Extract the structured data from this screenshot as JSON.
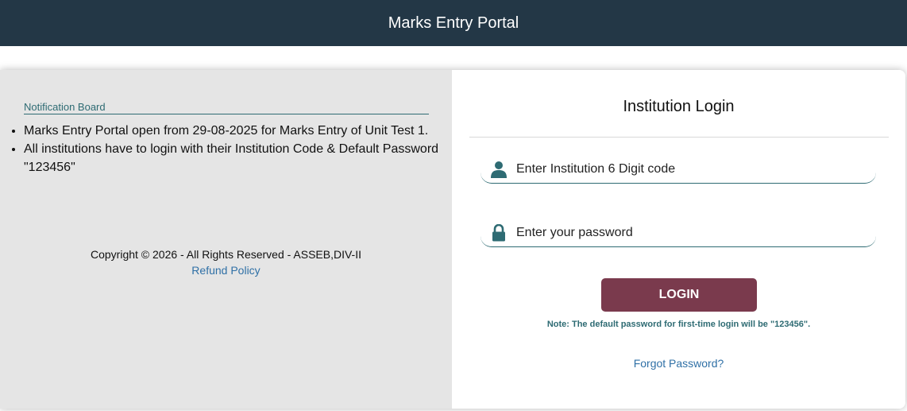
{
  "header": {
    "title": "Marks Entry Portal"
  },
  "notifications": {
    "title": "Notification Board",
    "items": [
      "Marks Entry Portal open from 29-08-2025 for Marks Entry of Unit Test 1.",
      "All institutions have to login with their Institution Code & Default Password \"123456\""
    ]
  },
  "footer": {
    "copyright": "Copyright © 2026 - All Rights Reserved - ASSEB,DIV-II",
    "refund_label": "Refund Policy"
  },
  "login": {
    "title": "Institution Login",
    "code_placeholder": "Enter Institution 6 Digit code",
    "password_placeholder": "Enter your password",
    "button_label": "LOGIN",
    "note": "Note: The default password for first-time login will be \"123456\".",
    "forgot_label": "Forgot Password?"
  },
  "icons": {
    "user": "user-icon",
    "lock": "lock-icon"
  },
  "colors": {
    "header_bg": "#233746",
    "accent": "#2e6b73",
    "button_bg": "#7a3a4d",
    "link": "#2f70a6"
  }
}
